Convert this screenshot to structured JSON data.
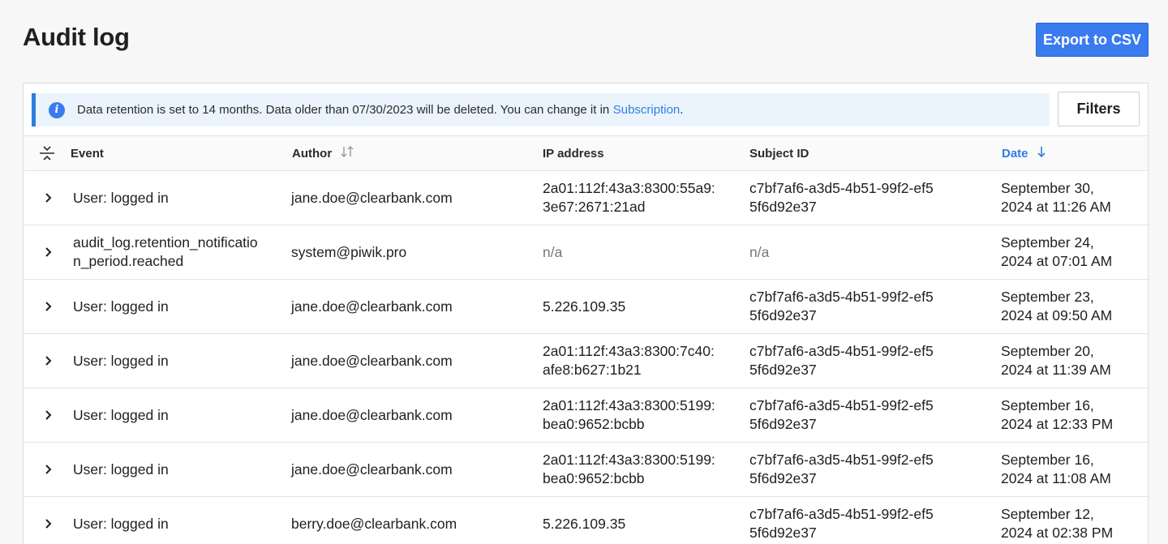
{
  "page": {
    "title": "Audit log",
    "export_label": "Export to CSV"
  },
  "banner": {
    "text": "Data retention is set to 14 months. Data older than 07/30/2023 will be deleted. You can change it in ",
    "link": "Subscription",
    "suffix": "."
  },
  "filters_label": "Filters",
  "columns": {
    "event": "Event",
    "author": "Author",
    "ip": "IP address",
    "subject": "Subject ID",
    "date": "Date"
  },
  "rows": [
    {
      "event": "User: logged in",
      "author": "jane.doe@clearbank.com",
      "ip": "2a01:112f:43a3:8300:55a9:3e67:2671:21ad",
      "subject": "c7bf7af6-a3d5-4b51-99f2-ef55f6d92e37",
      "date_line1": "September 30,",
      "date_line2": "2024 at 11:26 AM"
    },
    {
      "event": "audit_log.retention_notification_period.reached",
      "author": "system@piwik.pro",
      "ip": "n/a",
      "subject": "n/a",
      "date_line1": "September 24,",
      "date_line2": "2024 at 07:01 AM"
    },
    {
      "event": "User: logged in",
      "author": "jane.doe@clearbank.com",
      "ip": "5.226.109.35",
      "subject": "c7bf7af6-a3d5-4b51-99f2-ef55f6d92e37",
      "date_line1": "September 23,",
      "date_line2": "2024 at 09:50 AM"
    },
    {
      "event": "User: logged in",
      "author": "jane.doe@clearbank.com",
      "ip": "2a01:112f:43a3:8300:7c40:afe8:b627:1b21",
      "subject": "c7bf7af6-a3d5-4b51-99f2-ef55f6d92e37",
      "date_line1": "September 20,",
      "date_line2": "2024 at 11:39 AM"
    },
    {
      "event": "User: logged in",
      "author": "jane.doe@clearbank.com",
      "ip": "2a01:112f:43a3:8300:5199:bea0:9652:bcbb",
      "subject": "c7bf7af6-a3d5-4b51-99f2-ef55f6d92e37",
      "date_line1": "September 16,",
      "date_line2": "2024 at 12:33 PM"
    },
    {
      "event": "User: logged in",
      "author": "jane.doe@clearbank.com",
      "ip": "2a01:112f:43a3:8300:5199:bea0:9652:bcbb",
      "subject": "c7bf7af6-a3d5-4b51-99f2-ef55f6d92e37",
      "date_line1": "September 16,",
      "date_line2": "2024 at 11:08 AM"
    },
    {
      "event": "User: logged in",
      "author": "berry.doe@clearbank.com",
      "ip": "5.226.109.35",
      "subject": "c7bf7af6-a3d5-4b51-99f2-ef55f6d92e37",
      "date_line1": "September 12,",
      "date_line2": "2024 at 02:38 PM"
    }
  ],
  "icons": {
    "info": "info-icon",
    "expand": "chevron-right-icon",
    "collapse_all": "collapse-all-icon",
    "sort": "sort-icon",
    "sort_desc": "arrow-down-icon"
  },
  "colors": {
    "primary": "#3a7bf0",
    "link": "#2f7de1",
    "banner_bg": "#ebf4fd",
    "muted": "#777777"
  }
}
